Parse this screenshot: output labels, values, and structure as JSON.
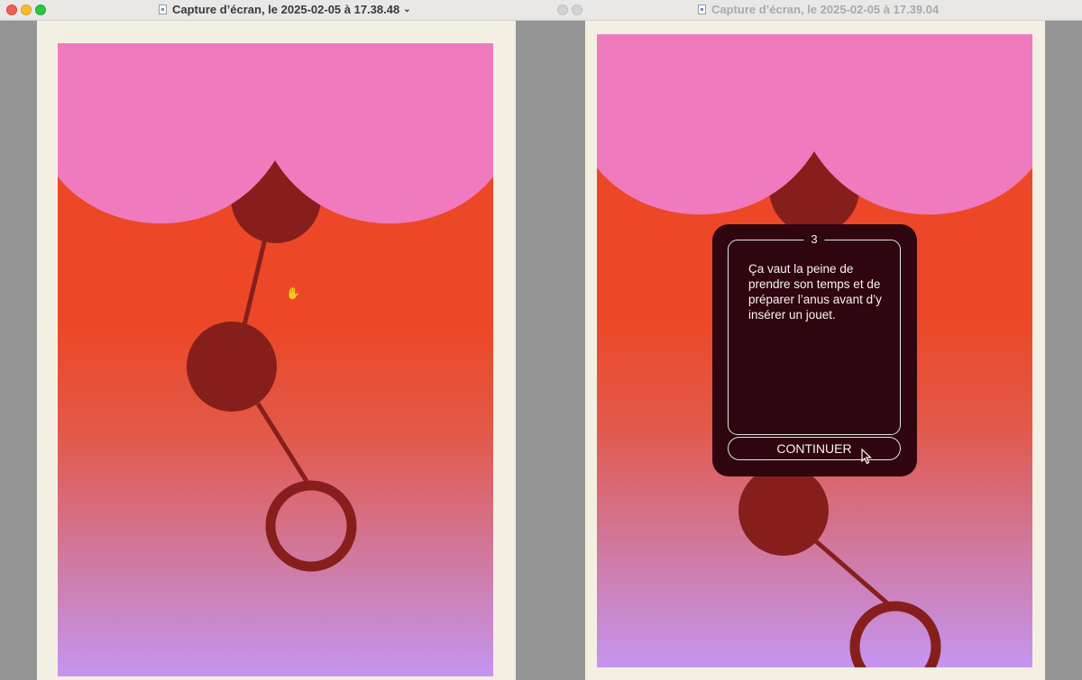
{
  "windows": {
    "left": {
      "title": "Capture d’écran, le 2025-02-05 à 17.38.48",
      "title_chevron": "⌄",
      "active": true
    },
    "right": {
      "title": "Capture d’écran, le 2025-02-05 à 17.39.04",
      "active": false
    }
  },
  "colors": {
    "pink": "#ef7bbe",
    "orange_red": "#ec4827",
    "lavender": "#c595f0",
    "bead_dark": "#861f1c",
    "card_bg": "#2f0510",
    "card_border": "#d6e9e6",
    "paper": "#f3f0e3"
  },
  "card": {
    "number": "3",
    "text": "Ça vaut la peine de prendre son temps et de préparer l’anus avant d’y insérer un jouet.",
    "button_label": "CONTINUER"
  },
  "icons": {
    "left_cursor": "grab-hand-icon",
    "right_cursor": "arrow-pointer-icon"
  }
}
